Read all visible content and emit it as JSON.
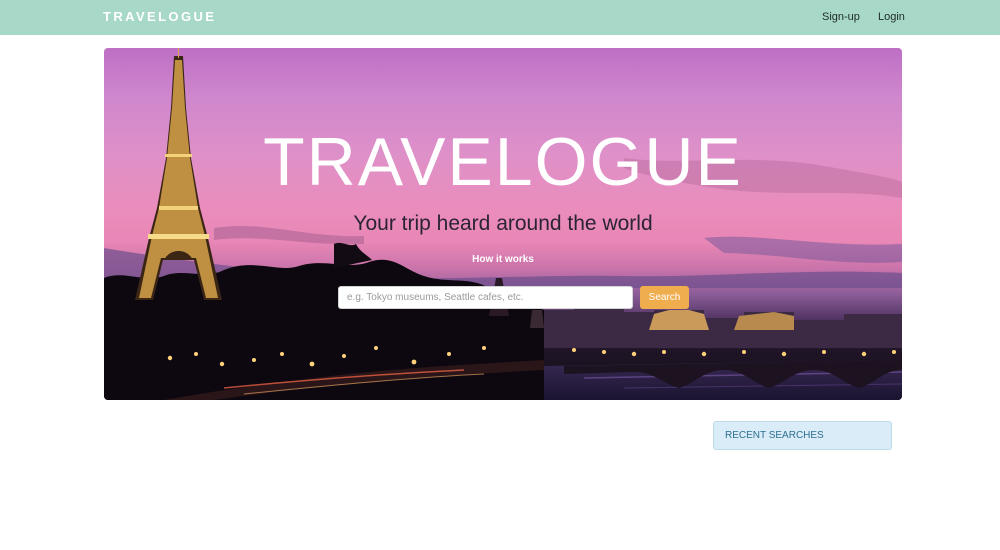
{
  "navbar": {
    "brand": "TRAVELOGUE",
    "links": [
      {
        "label": "Sign-up"
      },
      {
        "label": "Login"
      }
    ],
    "background_color": "#a8d9c8"
  },
  "hero": {
    "title": "TRAVELOGUE",
    "tagline": "Your trip heard around the world",
    "how_it_works": "How it works",
    "search": {
      "placeholder": "e.g. Tokyo museums, Seattle cafes, etc.",
      "value": "",
      "button_label": "Search",
      "button_color": "#f0ad4e"
    }
  },
  "sidebar": {
    "recent_searches_title": "RECENT SEARCHES"
  }
}
